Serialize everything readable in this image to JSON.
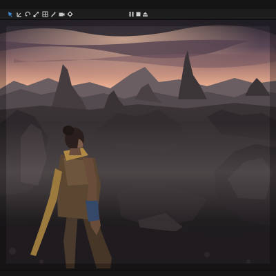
{
  "toolbar": {
    "left_tools": [
      {
        "icon": "select-arrow-icon",
        "active": true
      },
      {
        "icon": "translate-icon",
        "active": false
      },
      {
        "icon": "rotate-icon",
        "active": false
      },
      {
        "icon": "scale-icon",
        "active": false
      },
      {
        "icon": "grid-icon",
        "active": false
      },
      {
        "icon": "wand-icon",
        "active": false
      },
      {
        "icon": "camera-icon",
        "active": false
      },
      {
        "icon": "settings-icon",
        "active": false
      }
    ],
    "playback": [
      {
        "icon": "pause-icon"
      },
      {
        "icon": "stop-icon"
      },
      {
        "icon": "eject-icon"
      }
    ]
  },
  "colors": {
    "accent": "#3d8bd6",
    "icon": "#c8c8c8",
    "toolbar_bg": "#1d1d1d",
    "chrome_bg": "#141414"
  }
}
